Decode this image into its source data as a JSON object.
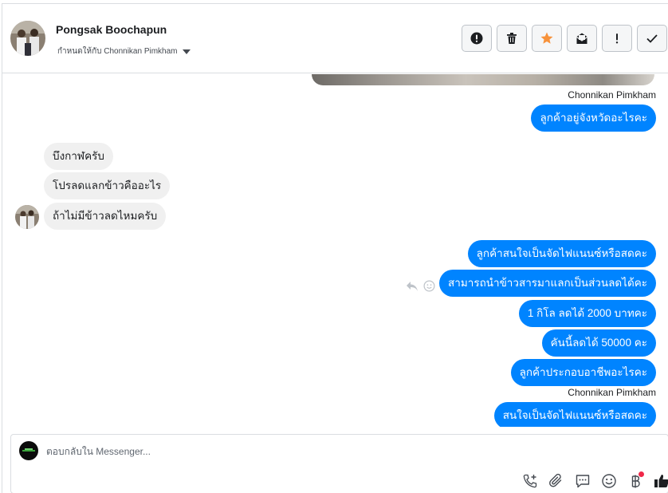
{
  "header": {
    "contact_name": "Pongsak Boochapun",
    "assigned_to": "กำหนดให้กับ Chonnikan Pimkham",
    "actions": [
      {
        "name": "mark-spam-button",
        "icon": "exclamation-circle-icon"
      },
      {
        "name": "delete-button",
        "icon": "trash-icon"
      },
      {
        "name": "star-button",
        "icon": "star-icon",
        "color": "#f7923b"
      },
      {
        "name": "mark-unread-button",
        "icon": "envelope-icon"
      },
      {
        "name": "follow-up-button",
        "icon": "exclamation-icon"
      },
      {
        "name": "mark-done-button",
        "icon": "check-icon"
      }
    ]
  },
  "messages": {
    "sender_label_1": "Chonnikan Pimkham",
    "out_1": "ลูกค้าอยู่จังหวัดอะไรคะ",
    "in_1": "บึงกาฬครับ",
    "in_2": "โปรลดแลกข้าวคืออะไร",
    "in_3": "ถ้าไม่มีข้าวลดไหมครับ",
    "out_2": "ลูกค้าสนใจเป็นจัดไฟแนนซ์หรือสดคะ",
    "out_3": "สามารถนำข้าวสารมาแลกเป็นส่วนลดได้คะ",
    "out_4": "1 กิโล ลดได้ 2000 บาทคะ",
    "out_5": "คันนี้ลดได้ 50000 คะ",
    "out_6": "ลูกค้าประกอบอาชีพอะไรคะ",
    "sender_label_2": "Chonnikan Pimkham",
    "out_7": "สนใจเป็นจัดไฟแนนซ์หรือสดคะ"
  },
  "composer": {
    "placeholder": "ตอบกลับใน Messenger...",
    "tools": [
      "phone-add-icon",
      "paperclip-icon",
      "saved-reply-icon",
      "emoji-icon",
      "baht-icon",
      "thumbs-up-icon"
    ]
  },
  "colors": {
    "outgoing_bubble": "#0084ff",
    "incoming_bubble": "#f0f0f0",
    "star": "#f7923b",
    "notification_dot": "#f02849"
  }
}
